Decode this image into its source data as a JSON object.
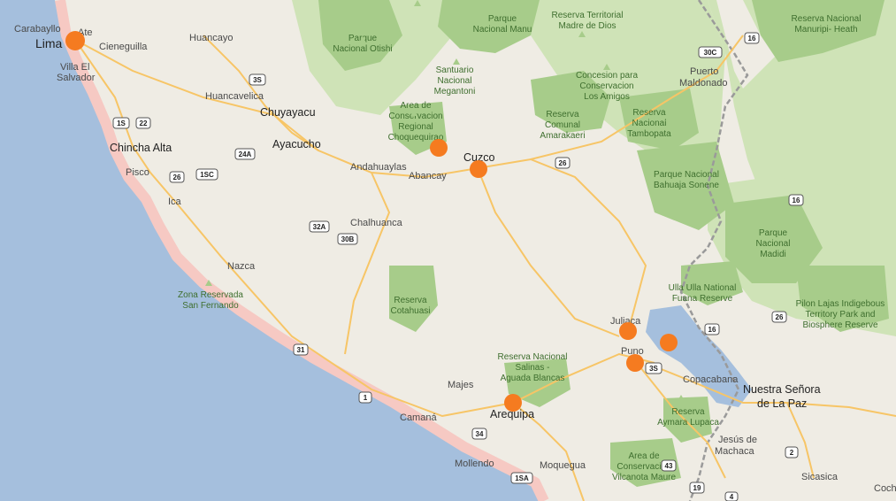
{
  "map": {
    "colors": {
      "water": "#a5bfdd",
      "land": "#efece4",
      "coast": "#f6c9c3",
      "forest": "#cfe3b7",
      "park": "#a7cc8a",
      "road": "#f7c566",
      "border": "#9a9a9a",
      "marker": "#f57b20"
    },
    "markers": [
      {
        "name": "Lima"
      },
      {
        "name": "Choquequirao"
      },
      {
        "name": "Cuzco"
      },
      {
        "name": "Juliaca"
      },
      {
        "name": "Lake Titicaca"
      },
      {
        "name": "Puno"
      },
      {
        "name": "Arequipa"
      }
    ],
    "labels": {
      "carabayllo": "Carabayllo",
      "ate": "Ate",
      "lima": "Lima",
      "cieneguilla": "Cieneguilla",
      "villa_el": "Villa El",
      "salvador": "Salvador",
      "huancayo": "Huancayo",
      "huancavelica": "Huancavelica",
      "chuyayacu": "Chuyayacu",
      "ayacucho": "Ayacucho",
      "chincha_alta": "Chincha Alta",
      "pisco": "Pisco",
      "ica": "Ica",
      "andahuaylas": "Andahuaylas",
      "abancay": "Abancay",
      "cuzco": "Cuzco",
      "chalhuanca": "Chalhuanca",
      "nazca": "Nazca",
      "puerto": "Puerto",
      "maldonado": "Maldonado",
      "juliaca": "Juliaca",
      "puno": "Puno",
      "majes": "Majes",
      "arequipa": "Arequipa",
      "camana": "Camaná",
      "mollendo": "Mollendo",
      "moquegua": "Moquegua",
      "copacabana": "Copacabana",
      "nuestra_senora": "Nuestra Señora",
      "de_la_paz": "de La Paz",
      "jesus_de": "Jesús de",
      "machaca": "Machaca",
      "sicasica": "Sicasica",
      "coch": "Coch"
    },
    "parks": {
      "otishi": [
        "Parque",
        "Nacional Otishi"
      ],
      "manu": [
        "Parque",
        "Nacional Manu"
      ],
      "madre_de_dios": [
        "Reserva Territorial",
        "Madre de Dios"
      ],
      "manuripi": [
        "Reserva Nacional",
        "Manuripi- Heath"
      ],
      "megantoni": [
        "Santuario",
        "Nacional",
        "Megantoni"
      ],
      "los_amigos": [
        "Concesion para",
        "Conservacion",
        "Los Amigos"
      ],
      "choquequirao": [
        "Area de",
        "Conservacion",
        "Regional",
        "Choquequirao"
      ],
      "amarakaeri": [
        "Reserva",
        "Comunal",
        "Amarakaeri"
      ],
      "tambopata": [
        "Reserva",
        "Nacional",
        "Tambopata"
      ],
      "bahuaja": [
        "Parque Nacional",
        "Bahuaja Sonene"
      ],
      "madidi": [
        "Parque",
        "Nacional",
        "Madidi"
      ],
      "san_fernando": [
        "Zona Reservada",
        "San Fernando"
      ],
      "cotahuasi": [
        "Reserva",
        "Cotahuasi"
      ],
      "fuana": [
        "Ulla Ulla National",
        "Fuana Reserve"
      ],
      "pilon_lajas": [
        "Pilon Lajas Indigebous",
        "Territory Park and",
        "Biosphere Reserve"
      ],
      "salinas": [
        "Reserva Nacional",
        "Salinas -",
        "Aguada Blancas"
      ],
      "aymara": [
        "Reserva",
        "Aymara Lupaca"
      ],
      "vilcanota": [
        "Area de",
        "Conservacion",
        "Vilcanota Maure"
      ]
    },
    "shields": {
      "s30c": "30C",
      "s16a": "16",
      "s3s_a": "3S",
      "s1s": "1S",
      "s22": "22",
      "s24a": "24A",
      "s26a": "26",
      "s1sc": "1SC",
      "s26b": "26",
      "s32a": "32A",
      "s30b": "30B",
      "s16b": "16",
      "s26c": "26",
      "s16c": "16",
      "s31": "31",
      "s1": "1",
      "s3s_b": "3S",
      "s34": "34",
      "s2": "2",
      "s43": "43",
      "s19": "19",
      "s1sa": "1SA",
      "s4": "4"
    }
  }
}
